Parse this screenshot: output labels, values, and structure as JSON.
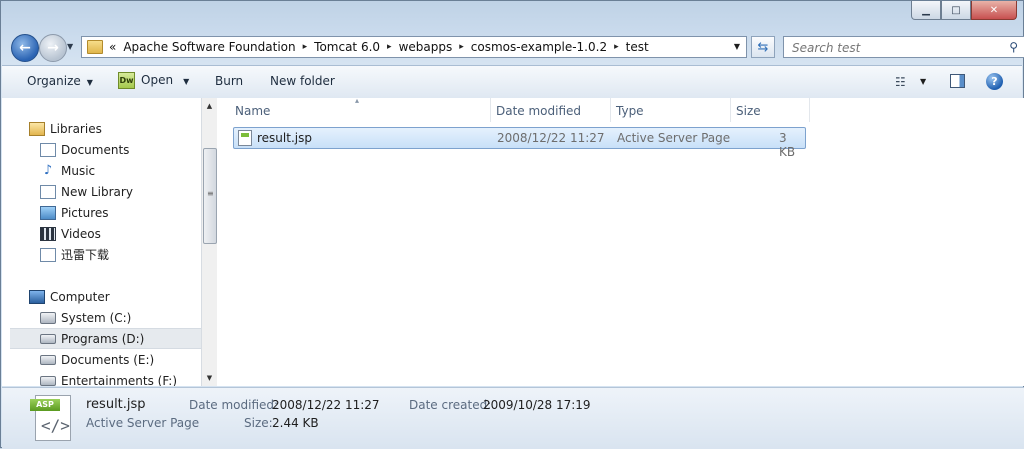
{
  "window": {
    "minimize_glyph": "▁",
    "maximize_glyph": "□",
    "close_glyph": "✕"
  },
  "address": {
    "prefix": "«",
    "crumbs": [
      "Apache Software Foundation",
      "Tomcat 6.0",
      "webapps",
      "cosmos-example-1.0.2",
      "test"
    ],
    "separator": "▸"
  },
  "search": {
    "placeholder": "Search test"
  },
  "toolbar": {
    "organize": "Organize",
    "open": "Open",
    "open_icon_text": "Dw",
    "burn": "Burn",
    "new_folder": "New folder"
  },
  "nav": {
    "libraries": "Libraries",
    "documents": "Documents",
    "music": "Music",
    "new_library": "New Library",
    "pictures": "Pictures",
    "videos": "Videos",
    "xunlei": "迅雷下载",
    "computer": "Computer",
    "system_c": "System (C:)",
    "programs_d": "Programs (D:)",
    "documents_e": "Documents (E:)",
    "entertainments_f": "Entertainments (F:)"
  },
  "columns": {
    "name": "Name",
    "date_modified": "Date modified",
    "type": "Type",
    "size": "Size"
  },
  "files": [
    {
      "name": "result.jsp",
      "date_modified": "2008/12/22 11:27",
      "type": "Active Server Page",
      "size": "3 KB"
    }
  ],
  "details": {
    "icon_tag": "ASP",
    "file_name": "result.jsp",
    "file_type": "Active Server Page",
    "date_modified_label": "Date modified:",
    "date_modified": "2008/12/22 11:27",
    "date_created_label": "Date created:",
    "date_created": "2009/10/28 17:19",
    "size_label": "Size:",
    "size": "2.44 KB"
  },
  "colors": {
    "selection": "#cce4f7",
    "accent": "#2a63b3"
  }
}
